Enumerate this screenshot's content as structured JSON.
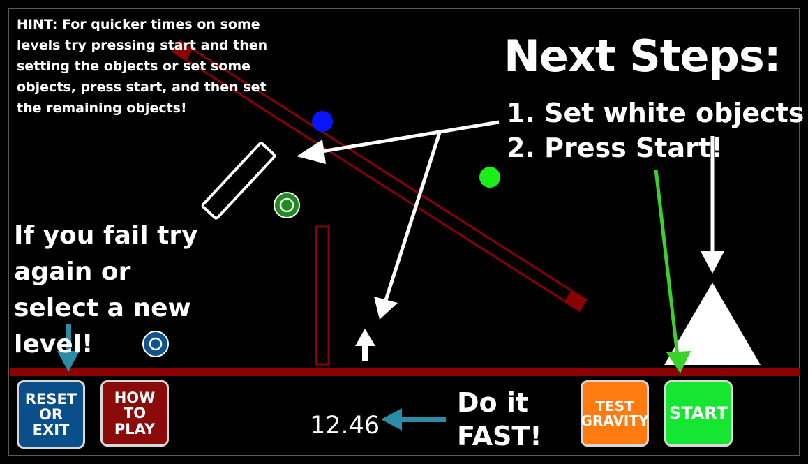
{
  "hint": "HINT: For quicker times on some levels try pressing start and then setting the objects or set some objects, press start, and then set the remaining objects!",
  "next_steps": {
    "title": "Next Steps:",
    "step1": "1. Set white objects",
    "step2": "2. Press Start!"
  },
  "fail_text": "If you fail try again or select a new level!",
  "do_it_fast": "Do it FAST!",
  "timer": "12.46",
  "buttons": {
    "reset": "RESET\nOR\nEXIT",
    "how_to_play": "HOW\nTO\nPLAY",
    "test_gravity": "TEST\nGRAVITY",
    "start": "START"
  },
  "colors": {
    "background": "#000000",
    "ground": "#8b0000",
    "reset_button": "#0b4f8a",
    "how_button": "#8b0a0a",
    "gravity_button": "#ff7a0f",
    "start_button": "#14e632",
    "blue_ball": "#0a14ff",
    "green_ball": "#19f019",
    "target_green": "#1f8c1f",
    "target_blue": "#11538f",
    "teal_arrow": "#2b8ca6",
    "green_arrow": "#3ad12a"
  },
  "icons": {
    "arrows": [
      "white-arrow-icon",
      "green-arrow-icon",
      "teal-arrow-icon"
    ]
  }
}
